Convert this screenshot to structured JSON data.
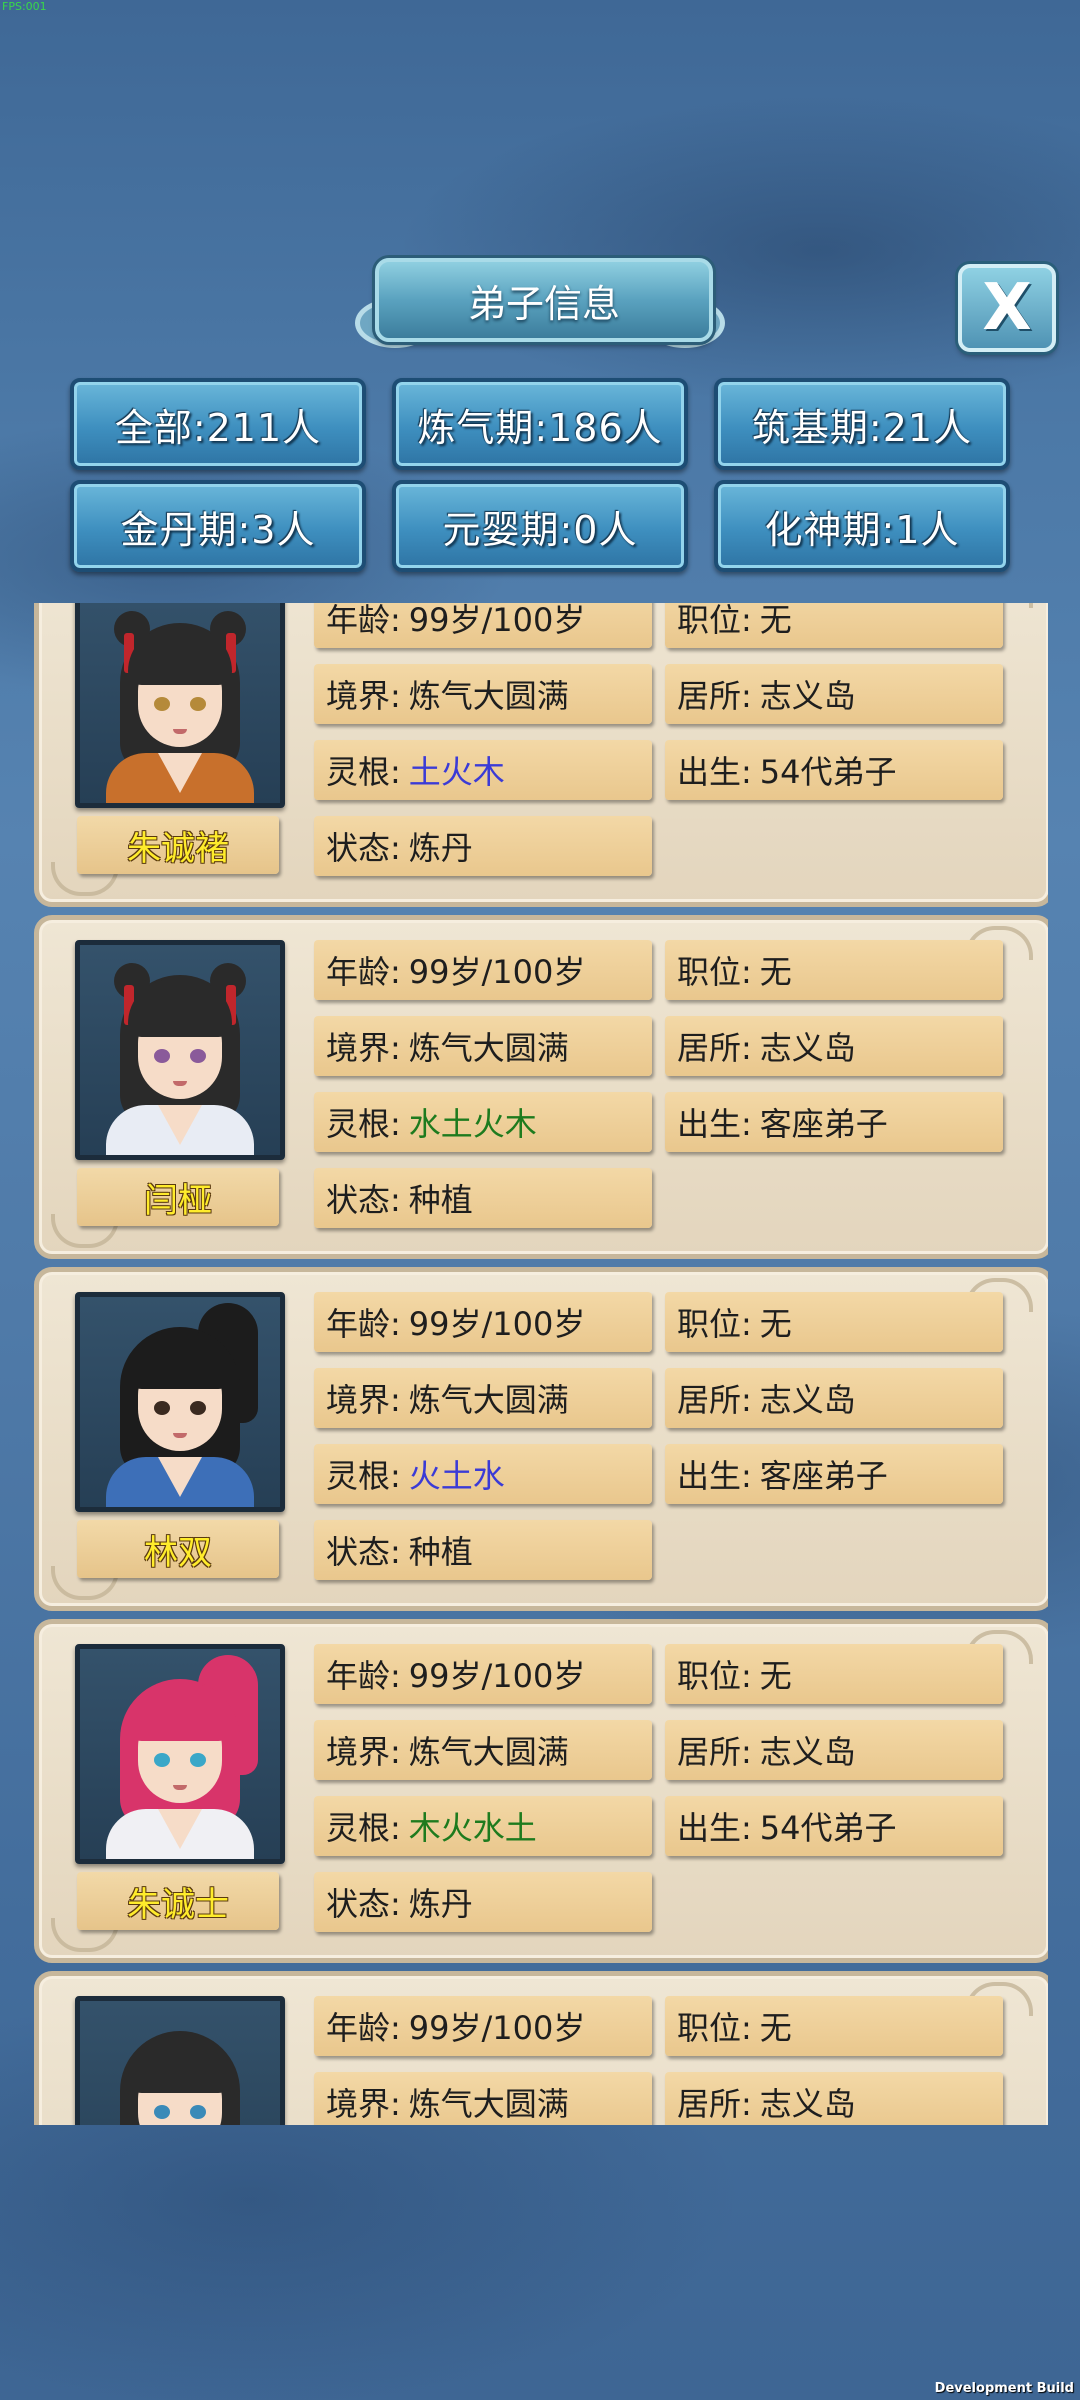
{
  "debug": {
    "fps": "FPS:001",
    "build": "Development Build"
  },
  "header": {
    "title": "弟子信息",
    "close_label": "X"
  },
  "filters": [
    {
      "label": "全部:211人"
    },
    {
      "label": "炼气期:186人"
    },
    {
      "label": "筑基期:21人"
    },
    {
      "label": "金丹期:3人"
    },
    {
      "label": "元婴期:0人"
    },
    {
      "label": "化神期:1人"
    }
  ],
  "labels": {
    "age": "年龄:",
    "realm": "境界:",
    "root": "灵根:",
    "status": "状态:",
    "position": "职位:",
    "residence": "居所:",
    "origin": "出生:"
  },
  "disciples": [
    {
      "name": "朱诚褚",
      "age": "99岁/100岁",
      "realm": "炼气大圆满",
      "root": "土火木",
      "root_color": "#3b3bd6",
      "status": "炼丹",
      "position": "无",
      "residence": "志义岛",
      "origin": "54代弟子",
      "hair": "#2a2a2a",
      "outfit": "#c8702c",
      "eyes": "#b58a3a"
    },
    {
      "name": "闫桠",
      "age": "99岁/100岁",
      "realm": "炼气大圆满",
      "root": "水土火木",
      "root_color": "#1e7b1e",
      "status": "种植",
      "position": "无",
      "residence": "志义岛",
      "origin": "客座弟子",
      "hair": "#2a2a2a",
      "outfit": "#e8ecf4",
      "eyes": "#8a5a9a"
    },
    {
      "name": "林双",
      "age": "99岁/100岁",
      "realm": "炼气大圆满",
      "root": "火土水",
      "root_color": "#3b3bd6",
      "status": "种植",
      "position": "无",
      "residence": "志义岛",
      "origin": "客座弟子",
      "hair": "#1c1c1c",
      "outfit": "#3d6fb8",
      "eyes": "#3a2a20"
    },
    {
      "name": "朱诚士",
      "age": "99岁/100岁",
      "realm": "炼气大圆满",
      "root": "木火水土",
      "root_color": "#1e7b1e",
      "status": "炼丹",
      "position": "无",
      "residence": "志义岛",
      "origin": "54代弟子",
      "hair": "#d8346a",
      "outfit": "#f0f0f4",
      "eyes": "#3aa7c8"
    },
    {
      "name": "",
      "age": "99岁/100岁",
      "realm": "炼气大圆满",
      "root": "",
      "root_color": "#1e7b1e",
      "status": "",
      "position": "无",
      "residence": "志义岛",
      "origin": "",
      "hair": "#2a2a2a",
      "outfit": "#d2dbe8",
      "eyes": "#3a8ab8"
    }
  ]
}
